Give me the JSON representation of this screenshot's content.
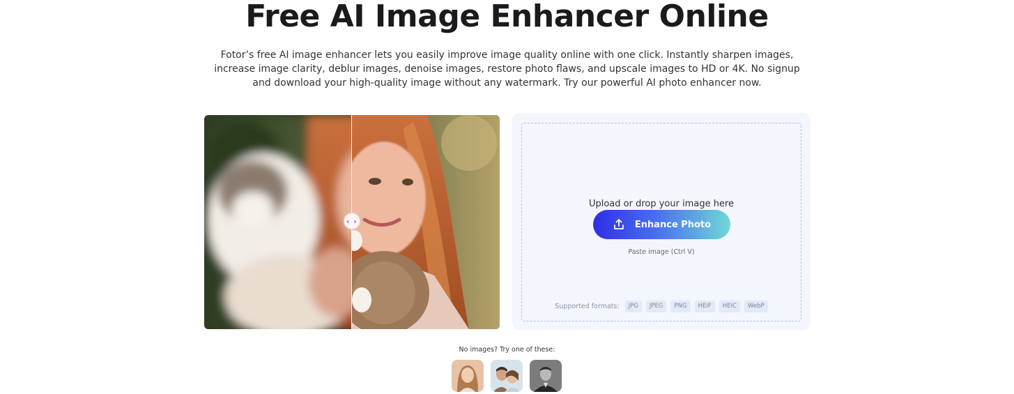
{
  "hero": {
    "title": "Free AI Image Enhancer Online",
    "description": "Fotor’s free AI image enhancer lets you easily improve image quality online with one click. Instantly sharpen images, increase image clarity, deblur images, denoise images, restore photo flaws, and upscale images to HD or 4K. No signup and download your high-quality image without any watermark. Try our powerful AI photo enhancer now."
  },
  "compare": {
    "handle_icon": "chevron-left-right-icon",
    "handle_text": "‹ ›"
  },
  "upload": {
    "prompt": "Upload or drop your image here",
    "button_label": "Enhance Photo",
    "button_icon": "upload-icon",
    "paste_hint": "Paste image (Ctrl V)",
    "formats_label": "Supported formats:",
    "formats": [
      "JPG",
      "JPEG",
      "PNG",
      "HEIF",
      "HEIC",
      "WebP"
    ]
  },
  "samples": {
    "label": "No images? Try one of these:"
  },
  "colors": {
    "accent_start": "#2f2fe6",
    "accent_end": "#6fd9d6",
    "panel_bg": "#f3f6fd"
  }
}
